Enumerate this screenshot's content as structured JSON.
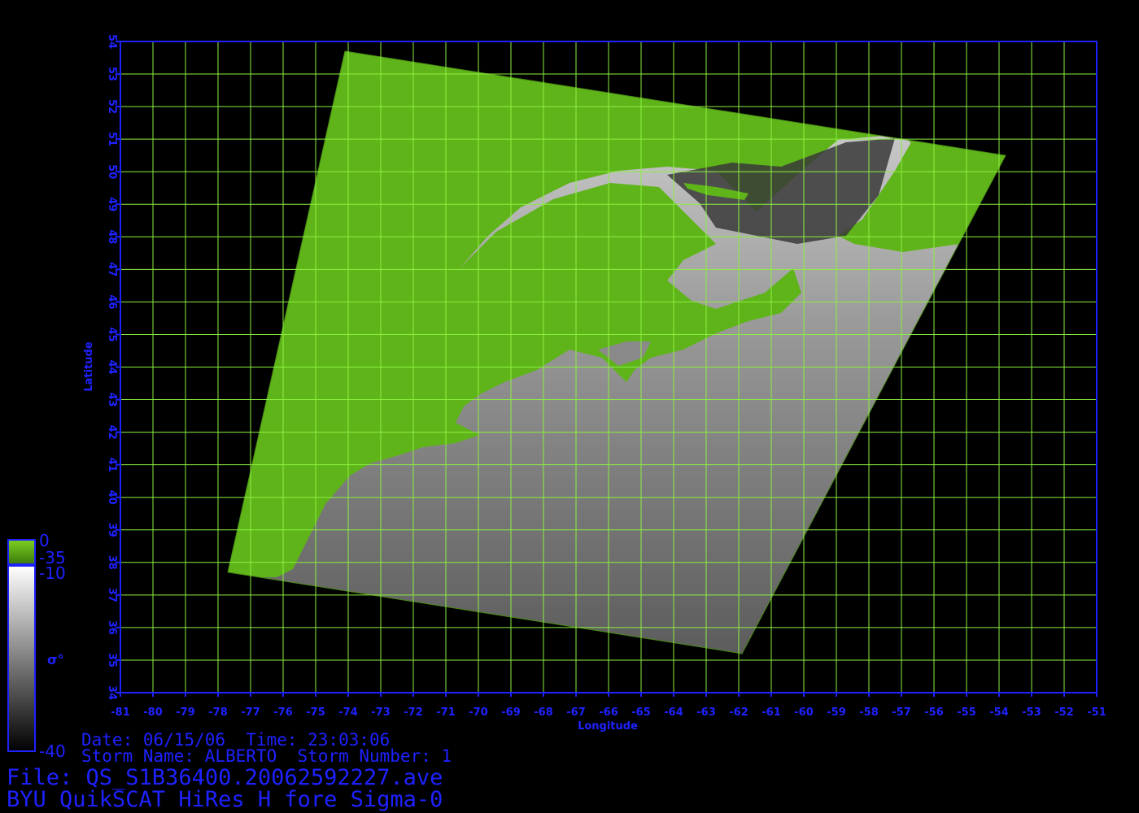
{
  "map": {
    "type": "satellite_swath_map",
    "x_axis": {
      "label": "Longitude",
      "min": -81,
      "max": -51,
      "ticks": [
        -81,
        -80,
        -79,
        -78,
        -77,
        -76,
        -75,
        -74,
        -73,
        -72,
        -71,
        -70,
        -69,
        -68,
        -67,
        -66,
        -65,
        -64,
        -63,
        -62,
        -61,
        -60,
        -59,
        -58,
        -57,
        -56,
        -55,
        -54,
        -53,
        -52,
        -51
      ]
    },
    "y_axis": {
      "label": "Latitude",
      "min": 34,
      "max": 54,
      "ticks": [
        34,
        35,
        36,
        37,
        38,
        39,
        40,
        41,
        42,
        43,
        44,
        45,
        46,
        47,
        48,
        49,
        50,
        51,
        52,
        53,
        54
      ]
    },
    "grid": true,
    "colors": {
      "axis": "#1e22ff",
      "grid": "#8cf040",
      "land": "#5fb41a",
      "background": "#000000"
    },
    "swath_corners_lonlat": [
      [
        -74.1,
        53.7
      ],
      [
        -53.8,
        50.5
      ],
      [
        -61.9,
        35.2
      ],
      [
        -77.7,
        37.7
      ]
    ]
  },
  "colorbar": {
    "land_top": "0",
    "land_bottom": "-35",
    "ocean_top": "-10",
    "ocean_bottom": "-40",
    "symbol": "σ°",
    "land_color": "#5fb41a",
    "ocean_colors": [
      "#ffffff",
      "#000000"
    ]
  },
  "info": {
    "date_line": "Date: 06/15/06  Time: 23:03:06",
    "storm_line": "Storm Name: ALBERTO  Storm Number: 1",
    "file_line": "File: QS_S1B36400.20062592227.ave",
    "product_line": "BYU QuikSCAT HiRes H fore Sigma-0"
  }
}
